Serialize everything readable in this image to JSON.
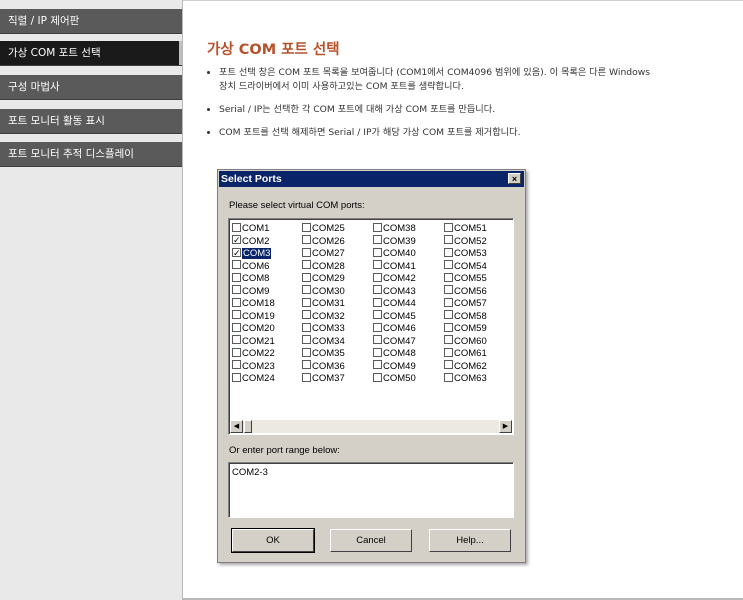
{
  "sidebar": {
    "items": [
      {
        "label": "직렬 / IP 제어판",
        "active": false
      },
      {
        "label": "가상 COM 포트 선택",
        "active": true
      },
      {
        "label": "구성 마법사",
        "active": false
      },
      {
        "label": "포트 모니터 활동 표시",
        "active": false
      },
      {
        "label": "포트 모니터 추적 디스플레이",
        "active": false
      }
    ]
  },
  "main": {
    "title": "가상 COM 포트 선택",
    "bullets": [
      "포트 선택 창은 COM 포트 목록을 보여줍니다 (COM1에서 COM4096 범위에 있음). 이 목록은 다른 Windows 장치 드라이버에서 이미 사용하고있는 COM 포트를 생략합니다.",
      "Serial / IP는 선택한 각 COM 포트에 대해 가상 COM 포트를 만듭니다.",
      "COM 포트를 선택 해제하면 Serial / IP가 해당 가상 COM 포트를 제거합니다."
    ]
  },
  "dialog": {
    "title": "Select Ports",
    "close_glyph": "×",
    "prompt": "Please select virtual COM ports:",
    "ports": [
      [
        "COM1",
        "COM2",
        "COM3",
        "COM6",
        "COM8",
        "COM9",
        "COM18",
        "COM19",
        "COM20",
        "COM21",
        "COM22",
        "COM23",
        "COM24"
      ],
      [
        "COM25",
        "COM26",
        "COM27",
        "COM28",
        "COM29",
        "COM30",
        "COM31",
        "COM32",
        "COM33",
        "COM34",
        "COM35",
        "COM36",
        "COM37"
      ],
      [
        "COM38",
        "COM39",
        "COM40",
        "COM41",
        "COM42",
        "COM43",
        "COM44",
        "COM45",
        "COM46",
        "COM47",
        "COM48",
        "COM49",
        "COM50"
      ],
      [
        "COM51",
        "COM52",
        "COM53",
        "COM54",
        "COM55",
        "COM56",
        "COM57",
        "COM58",
        "COM59",
        "COM60",
        "COM61",
        "COM62",
        "COM63"
      ]
    ],
    "checked": [
      "COM2",
      "COM3"
    ],
    "selected": "COM3",
    "scroll_left_glyph": "◀",
    "scroll_right_glyph": "▶",
    "range_label": "Or enter port range below:",
    "range_value": "COM2-3",
    "buttons": {
      "ok": "OK",
      "cancel": "Cancel",
      "help": "Help..."
    }
  },
  "colors": {
    "title": "#b5522a",
    "nav_bg": "#5a5a5a",
    "nav_active_bg": "#1a1a1a",
    "dialog_title_bg": "#0a246a",
    "dialog_bg": "#d4d0c8"
  }
}
